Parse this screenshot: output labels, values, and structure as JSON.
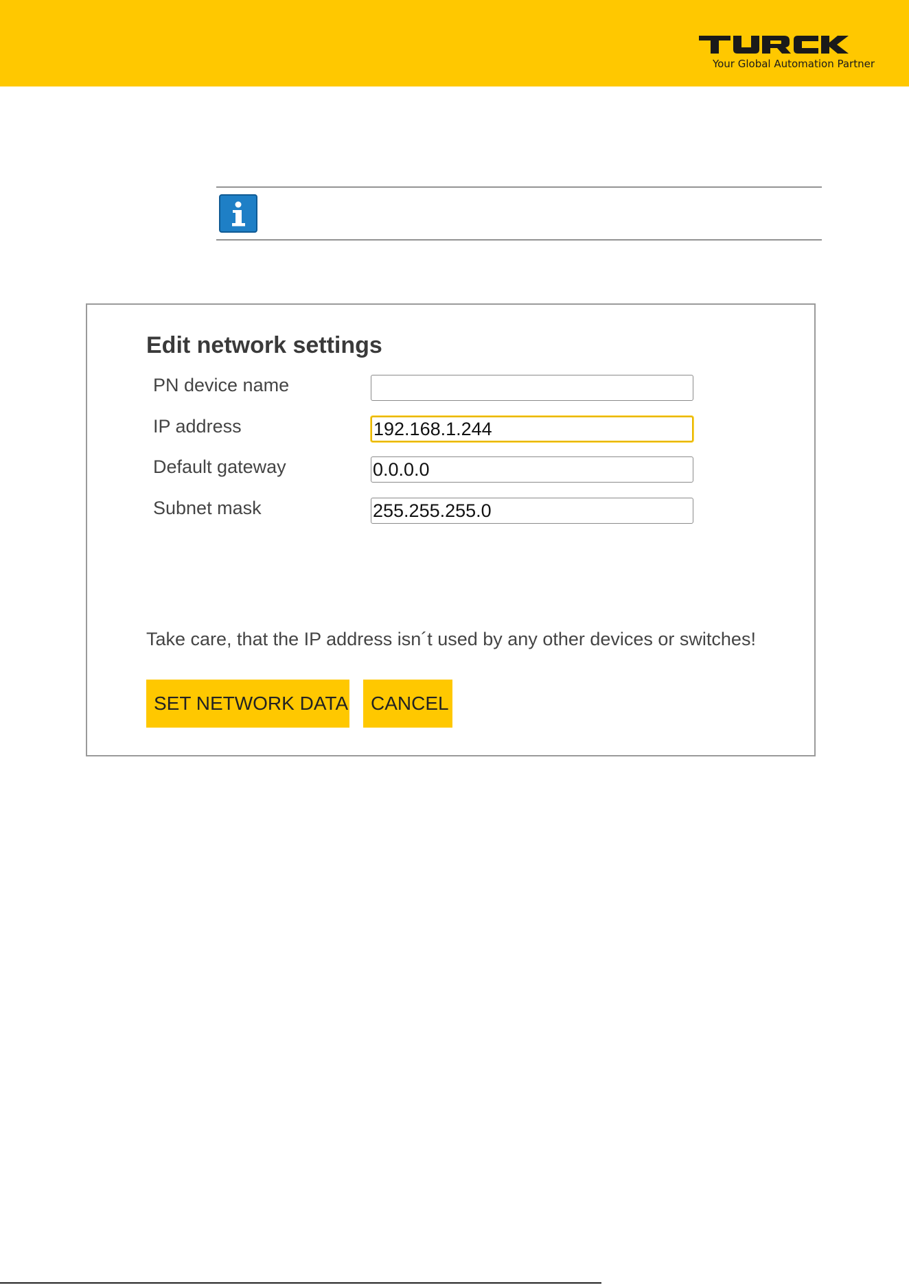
{
  "header": {
    "brand": "TURCK",
    "tagline": "Your Global Automation Partner",
    "band_color": "#FFC800"
  },
  "note": {
    "icon": "info-icon",
    "icon_color": "#1E7FC6"
  },
  "dialog": {
    "title": "Edit network settings",
    "fields": [
      {
        "label": "PN device name",
        "value": ""
      },
      {
        "label": "IP address",
        "value": "192.168.1.244"
      },
      {
        "label": "Default gateway",
        "value": "0.0.0.0"
      },
      {
        "label": "Subnet mask",
        "value": "255.255.255.0"
      }
    ],
    "warning": "Take care, that the IP address isn´t used by any other devices or switches!",
    "buttons": {
      "set_label": "SET NETWORK DATA",
      "cancel_label": "CANCEL"
    },
    "accent_color": "#FFC800"
  }
}
